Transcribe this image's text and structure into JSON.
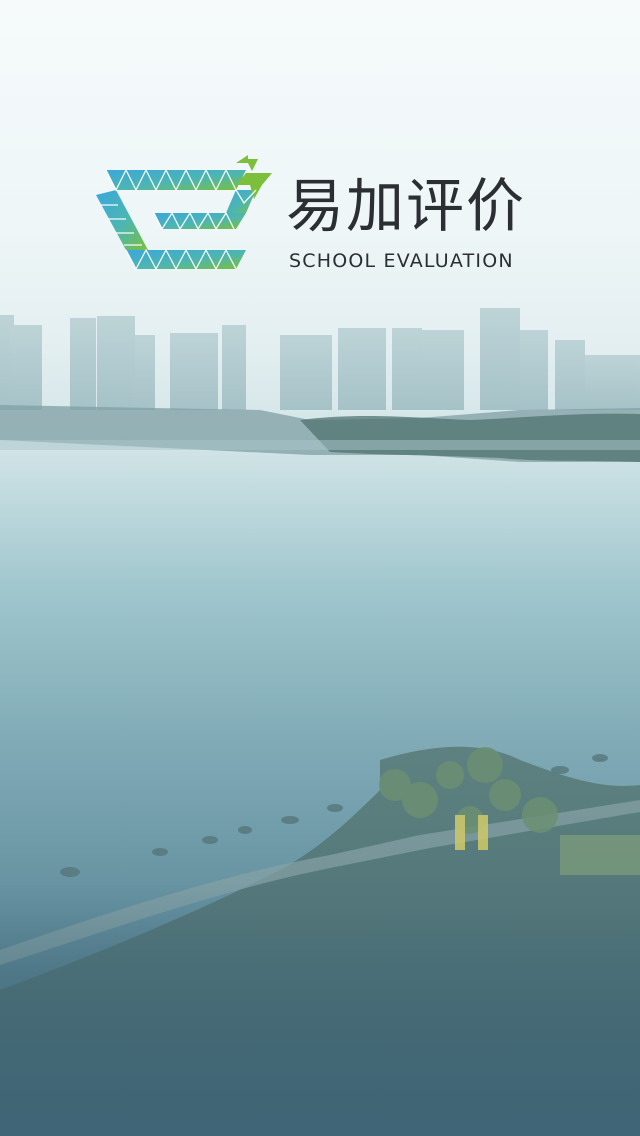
{
  "brand": {
    "name": "易加评价",
    "tagline": "SCHOOL EVALUATION"
  },
  "colors": {
    "logo_blue": "#3aa7db",
    "logo_green": "#7bbf3a",
    "text_dark": "#2b2f33",
    "sky_top": "#f6fafb",
    "water_bottom": "#3f6576"
  },
  "icons": {
    "logo": "triangle-mosaic-e-plus-logo"
  }
}
